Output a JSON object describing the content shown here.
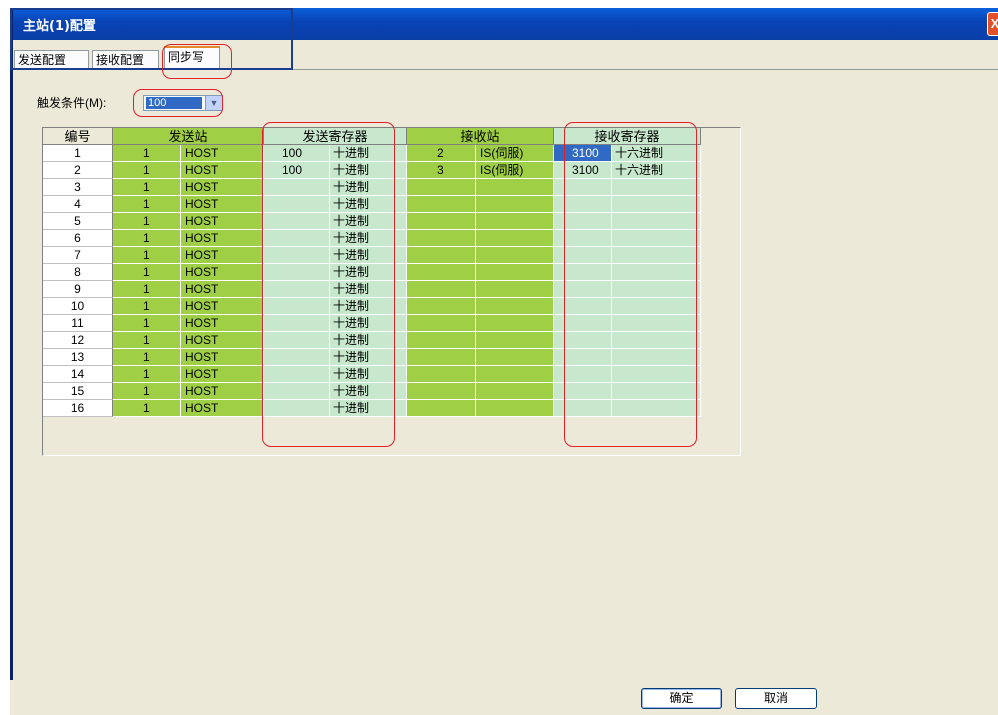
{
  "window": {
    "title": "主站(1)配置",
    "close_glyph": "X"
  },
  "tabs": [
    {
      "label": "发送配置",
      "active": false
    },
    {
      "label": "接收配置",
      "active": false
    },
    {
      "label": "同步写",
      "active": true
    }
  ],
  "trigger": {
    "label": "触发条件(M):",
    "value": "100"
  },
  "table": {
    "headers": {
      "num": "编号",
      "send_station": "发送站",
      "send_register": "发送寄存器",
      "recv_station": "接收站",
      "recv_register": "接收寄存器"
    },
    "rows": [
      {
        "num": "1",
        "s_id": "1",
        "s_name": "HOST",
        "s_reg": "100",
        "s_fmt": "十进制",
        "r_id": "2",
        "r_name": "IS(伺服)",
        "r_reg": "3100",
        "r_fmt": "十六进制"
      },
      {
        "num": "2",
        "s_id": "1",
        "s_name": "HOST",
        "s_reg": "100",
        "s_fmt": "十进制",
        "r_id": "3",
        "r_name": "IS(伺服)",
        "r_reg": "3100",
        "r_fmt": "十六进制"
      },
      {
        "num": "3",
        "s_id": "1",
        "s_name": "HOST",
        "s_reg": "",
        "s_fmt": "十进制",
        "r_id": "",
        "r_name": "",
        "r_reg": "",
        "r_fmt": ""
      },
      {
        "num": "4",
        "s_id": "1",
        "s_name": "HOST",
        "s_reg": "",
        "s_fmt": "十进制",
        "r_id": "",
        "r_name": "",
        "r_reg": "",
        "r_fmt": ""
      },
      {
        "num": "5",
        "s_id": "1",
        "s_name": "HOST",
        "s_reg": "",
        "s_fmt": "十进制",
        "r_id": "",
        "r_name": "",
        "r_reg": "",
        "r_fmt": ""
      },
      {
        "num": "6",
        "s_id": "1",
        "s_name": "HOST",
        "s_reg": "",
        "s_fmt": "十进制",
        "r_id": "",
        "r_name": "",
        "r_reg": "",
        "r_fmt": ""
      },
      {
        "num": "7",
        "s_id": "1",
        "s_name": "HOST",
        "s_reg": "",
        "s_fmt": "十进制",
        "r_id": "",
        "r_name": "",
        "r_reg": "",
        "r_fmt": ""
      },
      {
        "num": "8",
        "s_id": "1",
        "s_name": "HOST",
        "s_reg": "",
        "s_fmt": "十进制",
        "r_id": "",
        "r_name": "",
        "r_reg": "",
        "r_fmt": ""
      },
      {
        "num": "9",
        "s_id": "1",
        "s_name": "HOST",
        "s_reg": "",
        "s_fmt": "十进制",
        "r_id": "",
        "r_name": "",
        "r_reg": "",
        "r_fmt": ""
      },
      {
        "num": "10",
        "s_id": "1",
        "s_name": "HOST",
        "s_reg": "",
        "s_fmt": "十进制",
        "r_id": "",
        "r_name": "",
        "r_reg": "",
        "r_fmt": ""
      },
      {
        "num": "11",
        "s_id": "1",
        "s_name": "HOST",
        "s_reg": "",
        "s_fmt": "十进制",
        "r_id": "",
        "r_name": "",
        "r_reg": "",
        "r_fmt": ""
      },
      {
        "num": "12",
        "s_id": "1",
        "s_name": "HOST",
        "s_reg": "",
        "s_fmt": "十进制",
        "r_id": "",
        "r_name": "",
        "r_reg": "",
        "r_fmt": ""
      },
      {
        "num": "13",
        "s_id": "1",
        "s_name": "HOST",
        "s_reg": "",
        "s_fmt": "十进制",
        "r_id": "",
        "r_name": "",
        "r_reg": "",
        "r_fmt": ""
      },
      {
        "num": "14",
        "s_id": "1",
        "s_name": "HOST",
        "s_reg": "",
        "s_fmt": "十进制",
        "r_id": "",
        "r_name": "",
        "r_reg": "",
        "r_fmt": ""
      },
      {
        "num": "15",
        "s_id": "1",
        "s_name": "HOST",
        "s_reg": "",
        "s_fmt": "十进制",
        "r_id": "",
        "r_name": "",
        "r_reg": "",
        "r_fmt": ""
      },
      {
        "num": "16",
        "s_id": "1",
        "s_name": "HOST",
        "s_reg": "",
        "s_fmt": "十进制",
        "r_id": "",
        "r_name": "",
        "r_reg": "",
        "r_fmt": ""
      }
    ],
    "selected": {
      "row": 1,
      "column": "r_reg"
    }
  },
  "buttons": {
    "ok": "确定",
    "cancel": "取消"
  },
  "colors": {
    "title_bar": "#0842b4",
    "station_green": "#9fcf45",
    "register_green": "#c7e8cc",
    "annotation_red": "#e0202a",
    "selection_blue": "#316ac5"
  }
}
